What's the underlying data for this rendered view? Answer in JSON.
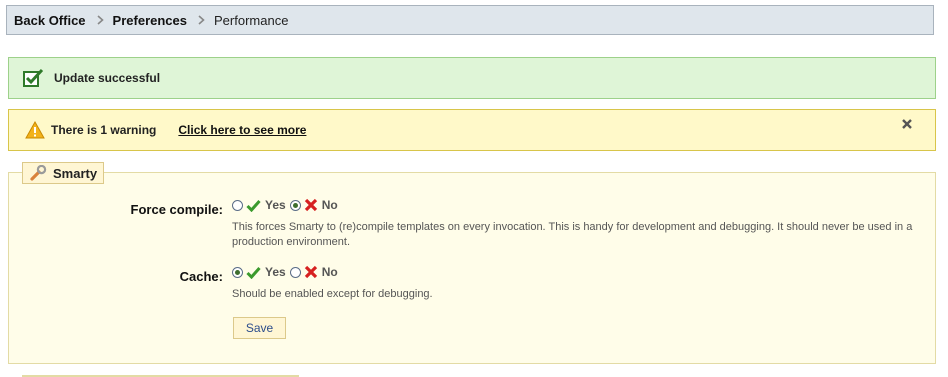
{
  "breadcrumb": {
    "items": [
      "Back Office",
      "Preferences",
      "Performance"
    ]
  },
  "alerts": {
    "success": {
      "text": "Update successful",
      "icon": "checkbox-check-icon"
    },
    "warning": {
      "text": "There is 1 warning",
      "link": "Click here to see more",
      "icon": "warning-triangle-icon",
      "close_icon": "close-icon"
    }
  },
  "smarty": {
    "legend": "Smarty",
    "legend_icon": "wrench-icon",
    "force_compile": {
      "label": "Force compile:",
      "yes": "Yes",
      "no": "No",
      "selected": "No",
      "help": "This forces Smarty to (re)compile templates on every invocation. This is handy for development and debugging. It should never be used in a production environment."
    },
    "cache": {
      "label": "Cache:",
      "yes": "Yes",
      "no": "No",
      "selected": "Yes",
      "help": "Should be enabled except for debugging."
    },
    "save": "Save"
  },
  "colors": {
    "success_bg": "#dff5d7",
    "warning_bg": "#fff9c9",
    "fieldset_bg": "#fffde9",
    "link_blue": "#2c4d8b"
  }
}
